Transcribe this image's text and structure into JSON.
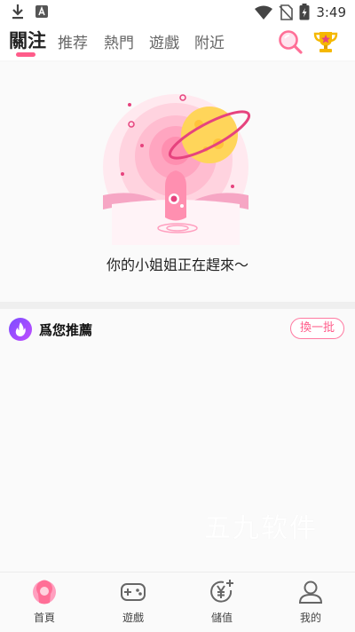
{
  "status_bar": {
    "time": "3:49",
    "icons": [
      "download-icon",
      "a-box-icon",
      "wifi-icon",
      "no-sim-icon",
      "battery-charging-icon"
    ]
  },
  "top_nav": {
    "tabs": [
      {
        "label": "關注",
        "active": true
      },
      {
        "label": "推荐",
        "active": false
      },
      {
        "label": "熱門",
        "active": false
      },
      {
        "label": "遊戲",
        "active": false
      },
      {
        "label": "附近",
        "active": false
      }
    ],
    "accent": "#ff5c8a",
    "right_icons": [
      "search-icon",
      "trophy-icon"
    ]
  },
  "empty_state": {
    "message": "你的小姐姐正在趕來～",
    "illustration": "planet-creature-illustration"
  },
  "recommend": {
    "title": "爲您推薦",
    "refresh_label": "換一批",
    "icon": "flame-icon"
  },
  "watermark": "五九软件",
  "bottom_nav": {
    "items": [
      {
        "label": "首頁",
        "icon": "home-icon",
        "active": true
      },
      {
        "label": "遊戲",
        "icon": "gamepad-icon",
        "active": false
      },
      {
        "label": "儲值",
        "icon": "yen-plus-icon",
        "active": false
      },
      {
        "label": "我的",
        "icon": "user-icon",
        "active": false
      }
    ]
  }
}
